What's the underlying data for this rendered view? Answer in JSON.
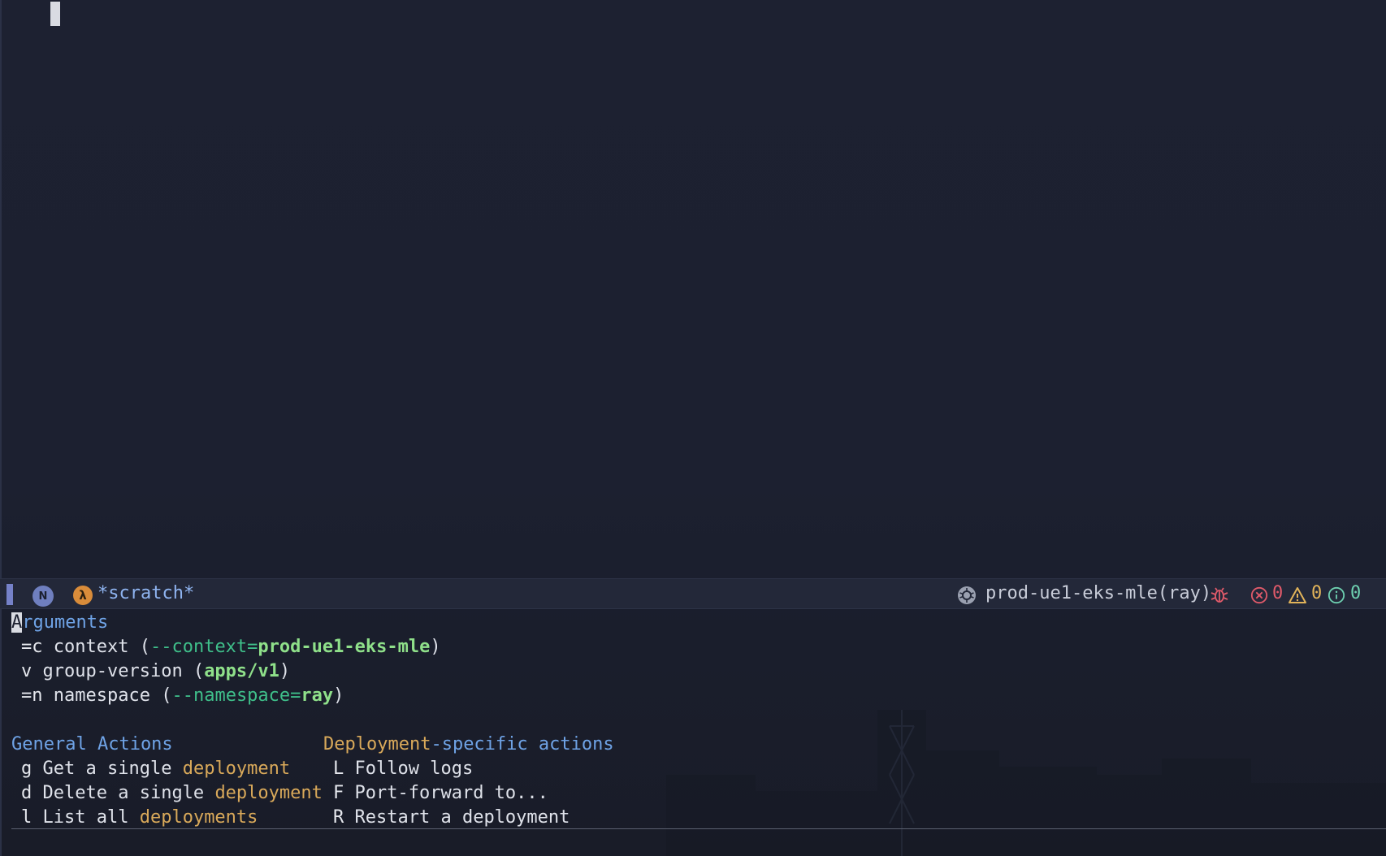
{
  "modeline": {
    "state_badge": "N",
    "mode_icon": "lambda-icon",
    "buffer_name": "*scratch*",
    "k8s_context": "prod-ue1-eks-mle(ray)",
    "errors": "0",
    "warnings": "0",
    "infos": "0"
  },
  "menu": {
    "arguments_heading_first": "A",
    "arguments_heading_rest": "rguments",
    "args": [
      {
        "key": "=c",
        "label": "context",
        "flag": "--context=",
        "value": "prod-ue1-eks-mle"
      },
      {
        "key": "v",
        "label": "group-version",
        "flag": "",
        "value": "apps/v1"
      },
      {
        "key": "=n",
        "label": "namespace",
        "flag": "--namespace=",
        "value": "ray"
      }
    ],
    "general_heading": "General Actions",
    "general": [
      {
        "key": "g",
        "text": "Get a single",
        "obj": "deployment"
      },
      {
        "key": "d",
        "text": "Delete a single",
        "obj": "deployment"
      },
      {
        "key": "l",
        "text": "List all",
        "obj": "deployments"
      }
    ],
    "specific_heading_a": "Deployment",
    "specific_heading_b": "-specific actions",
    "specific": [
      {
        "key": "L",
        "text": "Follow logs"
      },
      {
        "key": "F",
        "text": "Port-forward to..."
      },
      {
        "key": "R",
        "text": "Restart a deployment"
      }
    ]
  },
  "colors": {
    "background": "#1c2030",
    "heading": "#6fa3e6",
    "flag": "#3fbf8a",
    "value": "#8fe08a",
    "object": "#d9a95a",
    "error": "#e05a6a",
    "warning": "#e2b45a",
    "info": "#6ed0b0"
  }
}
